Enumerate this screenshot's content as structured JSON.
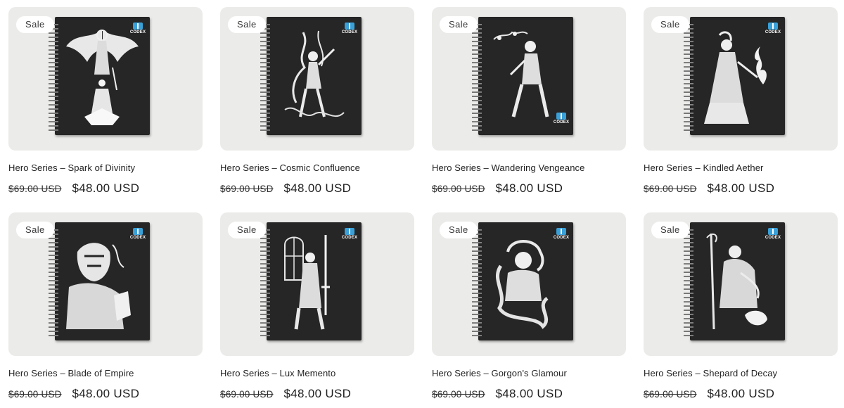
{
  "products": [
    {
      "badge": "Sale",
      "logo": "CODEX",
      "title": "Hero Series – Spark of Divinity",
      "old_price": "$69.00 USD",
      "new_price": "$48.00 USD"
    },
    {
      "badge": "Sale",
      "logo": "CODEX",
      "title": "Hero Series – Cosmic Confluence",
      "old_price": "$69.00 USD",
      "new_price": "$48.00 USD"
    },
    {
      "badge": "Sale",
      "logo": "CODEX",
      "title": "Hero Series – Wandering Vengeance",
      "old_price": "$69.00 USD",
      "new_price": "$48.00 USD"
    },
    {
      "badge": "Sale",
      "logo": "CODEX",
      "title": "Hero Series – Kindled Aether",
      "old_price": "$69.00 USD",
      "new_price": "$48.00 USD"
    },
    {
      "badge": "Sale",
      "logo": "CODEX",
      "title": "Hero Series – Blade of Empire",
      "old_price": "$69.00 USD",
      "new_price": "$48.00 USD"
    },
    {
      "badge": "Sale",
      "logo": "CODEX",
      "title": "Hero Series – Lux Memento",
      "old_price": "$69.00 USD",
      "new_price": "$48.00 USD"
    },
    {
      "badge": "Sale",
      "logo": "CODEX",
      "title": "Hero Series – Gorgon's Glamour",
      "old_price": "$69.00 USD",
      "new_price": "$48.00 USD"
    },
    {
      "badge": "Sale",
      "logo": "CODEX",
      "title": "Hero Series – Shepard of Decay",
      "old_price": "$69.00 USD",
      "new_price": "$48.00 USD"
    }
  ],
  "colors": {
    "card_background": "#ebebe9",
    "notebook_cover": "#262626",
    "logo_accent": "#3aa0d8",
    "badge_background": "#ffffff"
  }
}
